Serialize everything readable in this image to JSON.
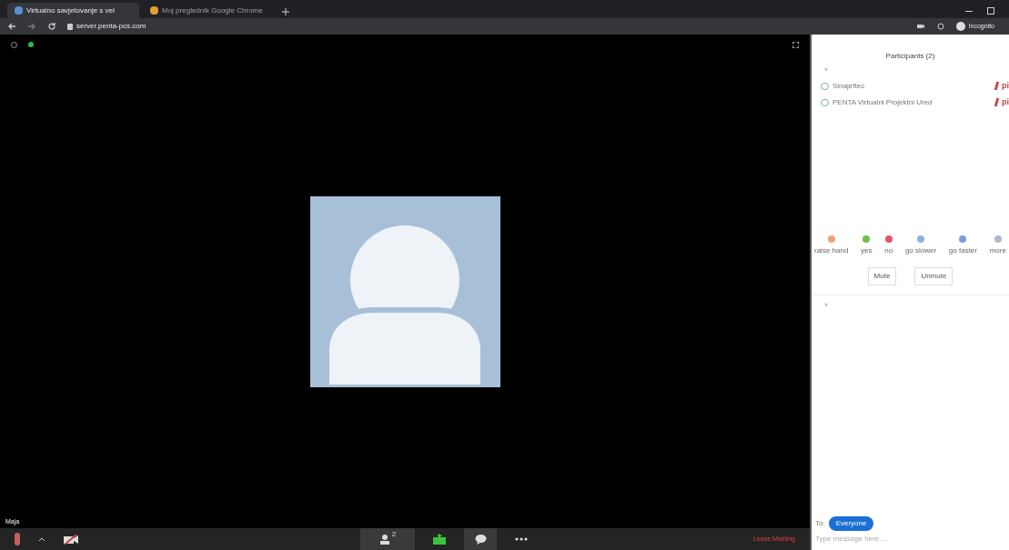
{
  "browser": {
    "tabs": [
      {
        "title": "Virtualno savjetovanje s vel",
        "selected": true
      },
      {
        "title": "Moj preglednik Google Chrome",
        "selected": false
      }
    ],
    "url_host": "server.penta-pcs.com",
    "profile": "Incognito"
  },
  "meeting": {
    "speaker_name": "Maja",
    "participants_count": "2",
    "leave": "Leave Meeting"
  },
  "participants_panel": {
    "title": "Participants (2)",
    "collapse": "˅",
    "people": [
      {
        "name": "Sinajeftec",
        "tag": "pi"
      },
      {
        "name": "PENTA Virtualni Projektni Ured",
        "tag": "pi"
      }
    ],
    "reactions": [
      {
        "label": "raise hand",
        "color": "#f0a070"
      },
      {
        "label": "yes",
        "color": "#6cc04a"
      },
      {
        "label": "no",
        "color": "#e8506a"
      },
      {
        "label": "go slower",
        "color": "#8ab4e0"
      },
      {
        "label": "go faster",
        "color": "#7b9fd8"
      },
      {
        "label": "more",
        "color": "#b0b8c8"
      }
    ],
    "buttons": [
      "Mute",
      "Unmute"
    ],
    "chat_collapse": "˅"
  },
  "chat": {
    "to_label": "To:",
    "recipient": "Everyone",
    "placeholder": "Type message here ..."
  }
}
